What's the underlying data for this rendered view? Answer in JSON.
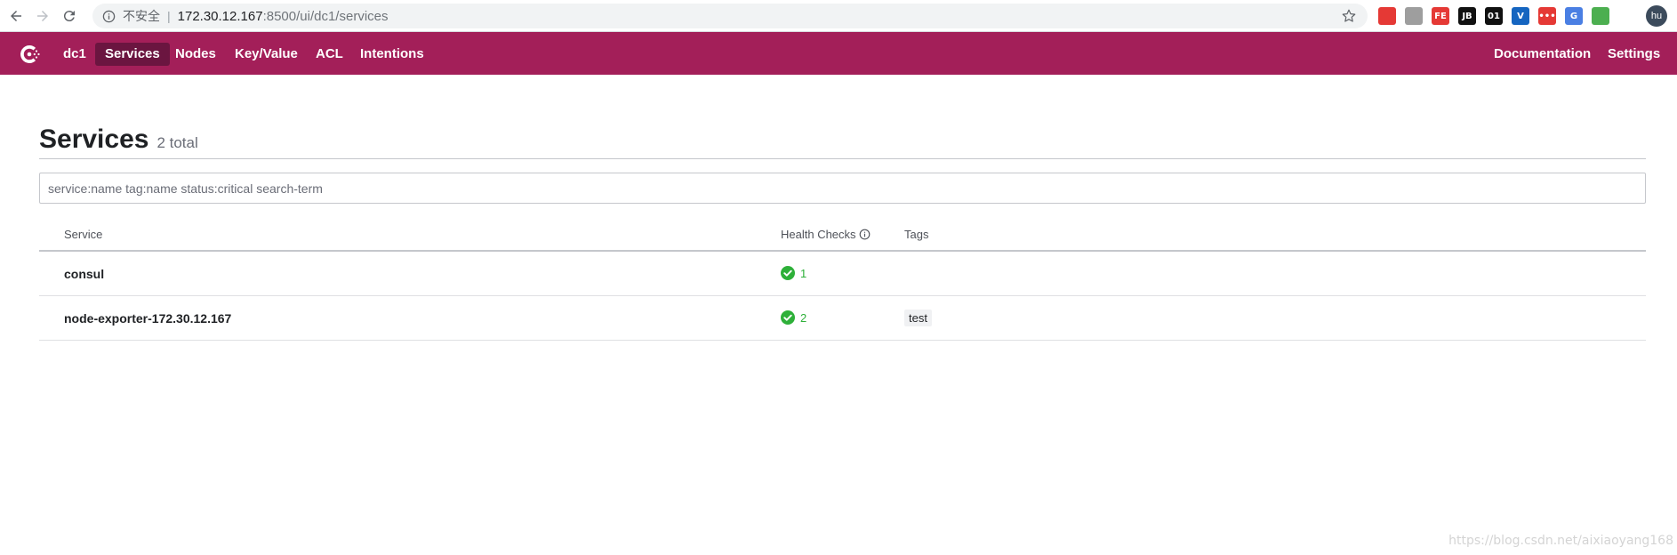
{
  "browser": {
    "insecure_label": "不安全",
    "separator": "|",
    "url_host": "172.30.12.167",
    "url_path": ":8500/ui/dc1/services",
    "extensions": [
      {
        "name": "adblock-icon",
        "label": "",
        "color": "#e53935"
      },
      {
        "name": "network-tree-icon",
        "label": "",
        "color": "#9e9e9e"
      },
      {
        "name": "fe-helper-icon",
        "label": "FE",
        "color": "#e53935"
      },
      {
        "name": "jetbrains-icon",
        "label": "JB",
        "color": "#111111"
      },
      {
        "name": "binary-icon",
        "label": "01",
        "color": "#111111"
      },
      {
        "name": "vue-devtools-icon",
        "label": "V",
        "color": "#1565c0"
      },
      {
        "name": "dots-extension-icon",
        "label": "•••",
        "color": "#e53935"
      },
      {
        "name": "translate-icon",
        "label": "G",
        "color": "#4a7fe3"
      },
      {
        "name": "home-extension-icon",
        "label": "",
        "color": "#4caf50"
      }
    ],
    "avatar_label": "hu"
  },
  "appbar": {
    "datacenter": "dc1",
    "nav": [
      {
        "label": "Services",
        "active": true
      },
      {
        "label": "Nodes",
        "active": false
      },
      {
        "label": "Key/Value",
        "active": false
      },
      {
        "label": "ACL",
        "active": false
      },
      {
        "label": "Intentions",
        "active": false
      }
    ],
    "right_nav": [
      {
        "label": "Documentation"
      },
      {
        "label": "Settings"
      }
    ],
    "color": "#a31f59"
  },
  "page": {
    "title": "Services",
    "count": "2 total",
    "search_placeholder": "service:name tag:name status:critical search-term"
  },
  "table": {
    "headers": {
      "service": "Service",
      "health": "Health Checks",
      "tags": "Tags"
    },
    "rows": [
      {
        "service": "consul",
        "health": "1",
        "tags": []
      },
      {
        "service": "node-exporter-172.30.12.167",
        "health": "2",
        "tags": [
          "test"
        ]
      }
    ]
  },
  "watermark": "https://blog.csdn.net/aixiaoyang168"
}
